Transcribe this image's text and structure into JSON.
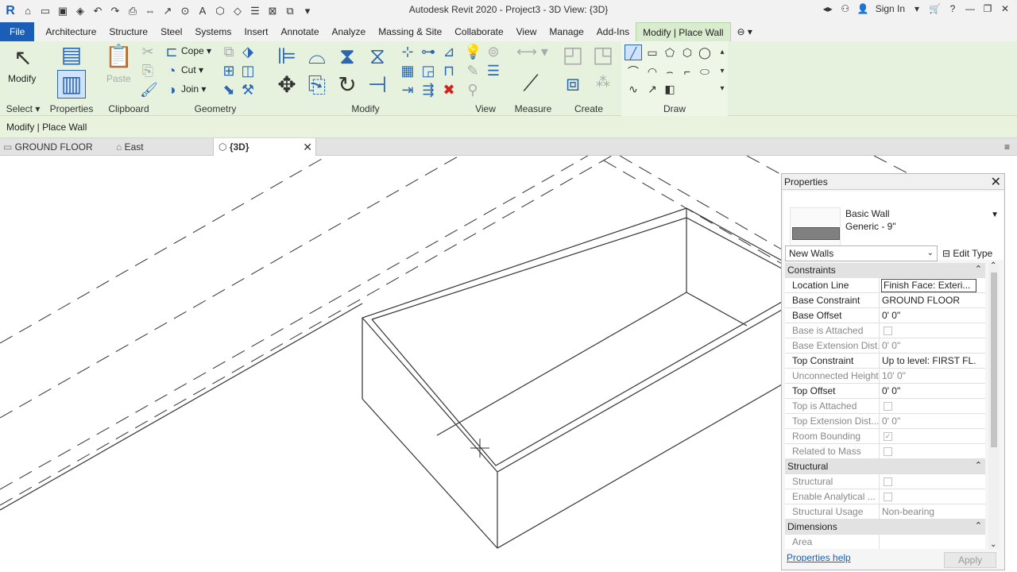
{
  "app": {
    "title": "Autodesk Revit 2020 - Project3 - 3D View: {3D}",
    "logo": "R",
    "sign_in": "Sign In"
  },
  "menu": [
    "File",
    "Architecture",
    "Structure",
    "Steel",
    "Systems",
    "Insert",
    "Annotate",
    "Analyze",
    "Massing & Site",
    "Collaborate",
    "View",
    "Manage",
    "Add-Ins",
    "Modify | Place Wall"
  ],
  "ribbon": {
    "select": {
      "modify_label": "Modify",
      "panel": "Select"
    },
    "properties": {
      "panel": "Properties"
    },
    "clipboard": {
      "paste": "Paste",
      "panel": "Clipboard"
    },
    "geometry": {
      "cope": "Cope",
      "cut": "Cut",
      "join": "Join",
      "panel": "Geometry"
    },
    "modify": {
      "panel": "Modify"
    },
    "view": {
      "panel": "View"
    },
    "measure": {
      "panel": "Measure"
    },
    "create": {
      "panel": "Create"
    },
    "draw": {
      "panel": "Draw"
    }
  },
  "context_bar": "Modify | Place Wall",
  "view_tabs": [
    {
      "label": "GROUND FLOOR"
    },
    {
      "label": "East"
    },
    {
      "label": "{3D}"
    }
  ],
  "properties": {
    "header": "Properties",
    "type_family": "Basic Wall",
    "type_name": "Generic - 9\"",
    "selector": "New Walls",
    "edit_type": "Edit Type",
    "help": "Properties help",
    "apply": "Apply",
    "categories": {
      "constraints": "Constraints",
      "structural": "Structural",
      "dimensions": "Dimensions"
    },
    "rows": [
      {
        "key": "Location Line",
        "value": "Finish Face: Exteri..."
      },
      {
        "key": "Base Constraint",
        "value": "GROUND FLOOR"
      },
      {
        "key": "Base Offset",
        "value": "0'  0\""
      },
      {
        "key": "Base is Attached",
        "value": ""
      },
      {
        "key": "Base Extension Dist...",
        "value": "0'  0\""
      },
      {
        "key": "Top Constraint",
        "value": "Up to level: FIRST FL..."
      },
      {
        "key": "Unconnected Height",
        "value": "10'  0\""
      },
      {
        "key": "Top Offset",
        "value": "0'  0\""
      },
      {
        "key": "Top is Attached",
        "value": ""
      },
      {
        "key": "Top Extension Dist...",
        "value": "0'  0\""
      },
      {
        "key": "Room Bounding",
        "value": ""
      },
      {
        "key": "Related to Mass",
        "value": ""
      },
      {
        "key": "Structural",
        "value": ""
      },
      {
        "key": "Enable Analytical ...",
        "value": ""
      },
      {
        "key": "Structural Usage",
        "value": "Non-bearing"
      },
      {
        "key": "Area",
        "value": ""
      }
    ]
  }
}
